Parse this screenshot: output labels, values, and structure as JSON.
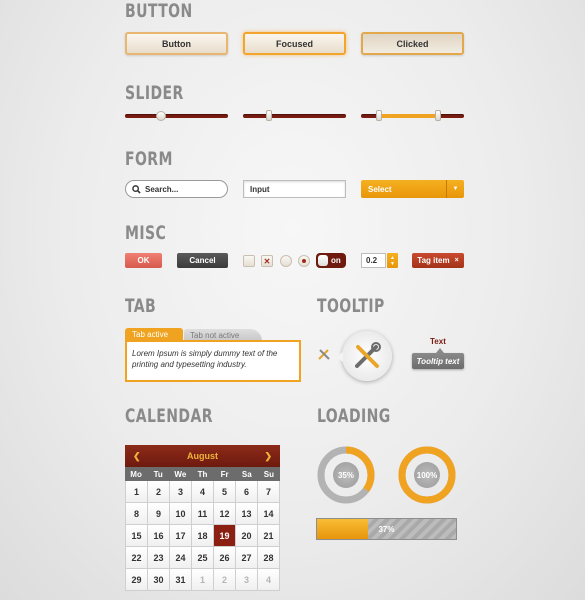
{
  "sections": {
    "button": "BUTTON",
    "slider": "SLIDER",
    "form": "FORM",
    "misc": "MISC",
    "tab": "TAB",
    "tooltip": "TOOLTIP",
    "calendar": "CALENDAR",
    "loading": "LOADING"
  },
  "buttons": {
    "normal": "Button",
    "focused": "Focused",
    "clicked": "Clicked"
  },
  "sliders": [
    {
      "value": 0.35
    },
    {
      "value": 0.25
    },
    {
      "range": [
        0.17,
        0.75
      ]
    }
  ],
  "form": {
    "search_placeholder": "Search...",
    "input_value": "Input",
    "select_value": "Select"
  },
  "misc": {
    "ok_label": "OK",
    "cancel_label": "Cancel",
    "toggle_label": "on",
    "stepper_value": "0.2",
    "tag_label": "Tag item",
    "tag_remove": "×"
  },
  "tab": {
    "active_label": "Tab active",
    "inactive_label": "Tab not active",
    "content": "Lorem Ipsum is simply dummy text of the printing and typesetting industry."
  },
  "tooltip": {
    "text_label": "Text",
    "tooltip_text": "Tooltip text"
  },
  "calendar": {
    "month": "August",
    "prev": "❮",
    "next": "❯",
    "weekdays": [
      "Mo",
      "Tu",
      "We",
      "Th",
      "Fr",
      "Sa",
      "Su"
    ],
    "weeks": [
      [
        "1",
        "2",
        "3",
        "4",
        "5",
        "6",
        "7"
      ],
      [
        "8",
        "9",
        "10",
        "11",
        "12",
        "13",
        "14"
      ],
      [
        "15",
        "16",
        "17",
        "18",
        "19",
        "20",
        "21"
      ],
      [
        "22",
        "23",
        "24",
        "25",
        "26",
        "27",
        "28"
      ],
      [
        "29",
        "30",
        "31",
        "1",
        "2",
        "3",
        "4"
      ]
    ],
    "selected": "19"
  },
  "loading": {
    "ring1_label": "35%",
    "ring1_value": 0.35,
    "ring2_label": "100%",
    "ring2_value": 1.0,
    "bar_label": "37%",
    "bar_value": 0.37
  },
  "colors": {
    "accent": "#f0a321",
    "dark_red": "#7a1b12",
    "ok": "#e36b5e",
    "cancel": "#4a4a4a"
  }
}
